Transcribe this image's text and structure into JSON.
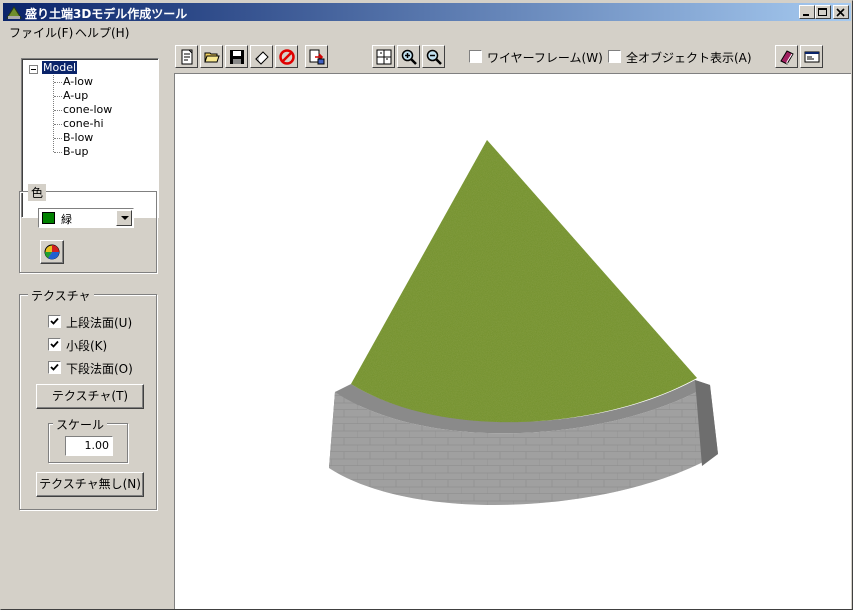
{
  "window": {
    "title": "盛り土端3Dモデル作成ツール",
    "controls": [
      "minimize",
      "maximize",
      "close"
    ]
  },
  "menu": {
    "file": "ファイル(F)",
    "help": "ヘルプ(H)"
  },
  "tree": {
    "root": "Model",
    "children": [
      "A-low",
      "A-up",
      "cone-low",
      "cone-hi",
      "B-low",
      "B-up"
    ]
  },
  "color_group": {
    "legend": "色",
    "selected_color": "緑",
    "swatch_color": "#008000"
  },
  "texture_group": {
    "legend": "テクスチャ",
    "checks": [
      {
        "label": "上段法面(U)",
        "checked": true
      },
      {
        "label": "小段(K)",
        "checked": true
      },
      {
        "label": "下段法面(O)",
        "checked": true
      }
    ],
    "texture_button": "テクスチャ(T)",
    "scale_legend": "スケール",
    "scale_value": "1.00",
    "no_texture_button": "テクスチャ無し(N)"
  },
  "toolbar": {
    "icons": [
      "new-document-icon",
      "open-folder-icon",
      "save-icon",
      "eraser-icon",
      "cancel-icon",
      "export-icon",
      "fit-view-icon",
      "zoom-in-icon",
      "zoom-out-icon",
      "book-icon",
      "info-card-icon"
    ],
    "wireframe_label": "ワイヤーフレーム(W)",
    "wireframe_checked": false,
    "all_objects_label": "全オブジェクト表示(A)",
    "all_objects_checked": false
  },
  "scene": {
    "grass_color": "#6f8f2c",
    "wall_color": "#9a9a9a"
  }
}
